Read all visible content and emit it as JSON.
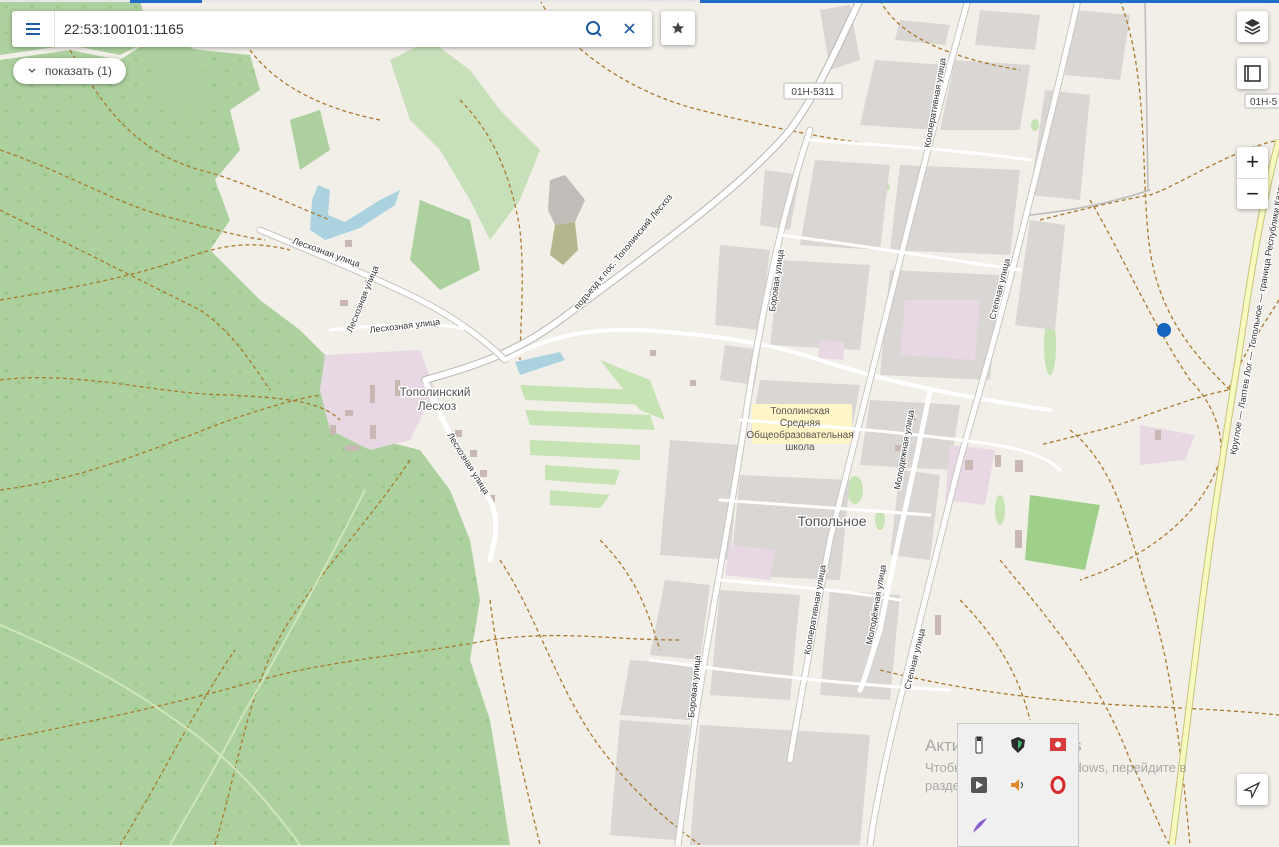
{
  "search": {
    "value": "22:53:100101:1165"
  },
  "filter": {
    "label": "показать (1)"
  },
  "map": {
    "places": {
      "village": "Топольное",
      "settlement_line1": "Тополинский",
      "settlement_line2": "Лесхоз",
      "school_line1": "Тополинская",
      "school_line2": "Средняя",
      "school_line3": "Общеобразовательная",
      "school_line4": "школа"
    },
    "roads": {
      "leskhoz_street": "Лесхозная улица",
      "access_road": "подъезд к пос. Тополинский Лесхоз",
      "borovaya": "Боровая улица",
      "kooperativnaya": "Кооперативная улица",
      "stepnaya": "Степная улица",
      "molodezhnaya": "Молодежная улица",
      "molodyozhnaya": "Молодёжная улица",
      "highway_long": "Круглое — Лаптев Лог — Топольное — граница Республики Казахстан"
    },
    "shields": {
      "road_main": "01Н-5311",
      "road_edge": "01Н-5"
    }
  },
  "windows_activation": {
    "title": "Активация Windows",
    "line1": "Чтобы активировать Windows, перейдите в",
    "line2": "раздел \"Параметры\"."
  },
  "colors": {
    "background": "#f2efe9",
    "forest": "#add19e",
    "built": "#d9d6d3",
    "school": "#fff5c6",
    "highway": "#f7fabf",
    "track": "#a8792b",
    "location_dot": "#1565c0",
    "accent": "#1f5aa6"
  }
}
